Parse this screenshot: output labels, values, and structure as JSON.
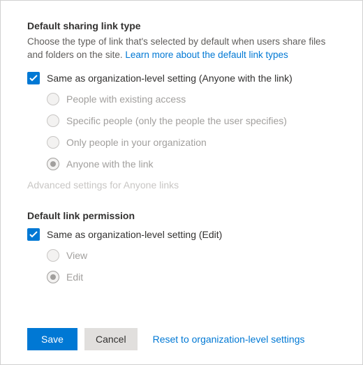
{
  "link_type": {
    "title": "Default sharing link type",
    "desc_prefix": "Choose the type of link that's selected by default when users share files and folders on the site. ",
    "learn_more": "Learn more about the default link types",
    "same_as_org": "Same as organization-level setting (Anyone with the link)",
    "options": [
      "People with existing access",
      "Specific people (only the people the user specifies)",
      "Only people in your organization",
      "Anyone with the link"
    ],
    "advanced": "Advanced settings for Anyone links"
  },
  "link_permission": {
    "title": "Default link permission",
    "same_as_org": "Same as organization-level setting (Edit)",
    "options": [
      "View",
      "Edit"
    ]
  },
  "footer": {
    "save": "Save",
    "cancel": "Cancel",
    "reset": "Reset to organization-level settings"
  }
}
